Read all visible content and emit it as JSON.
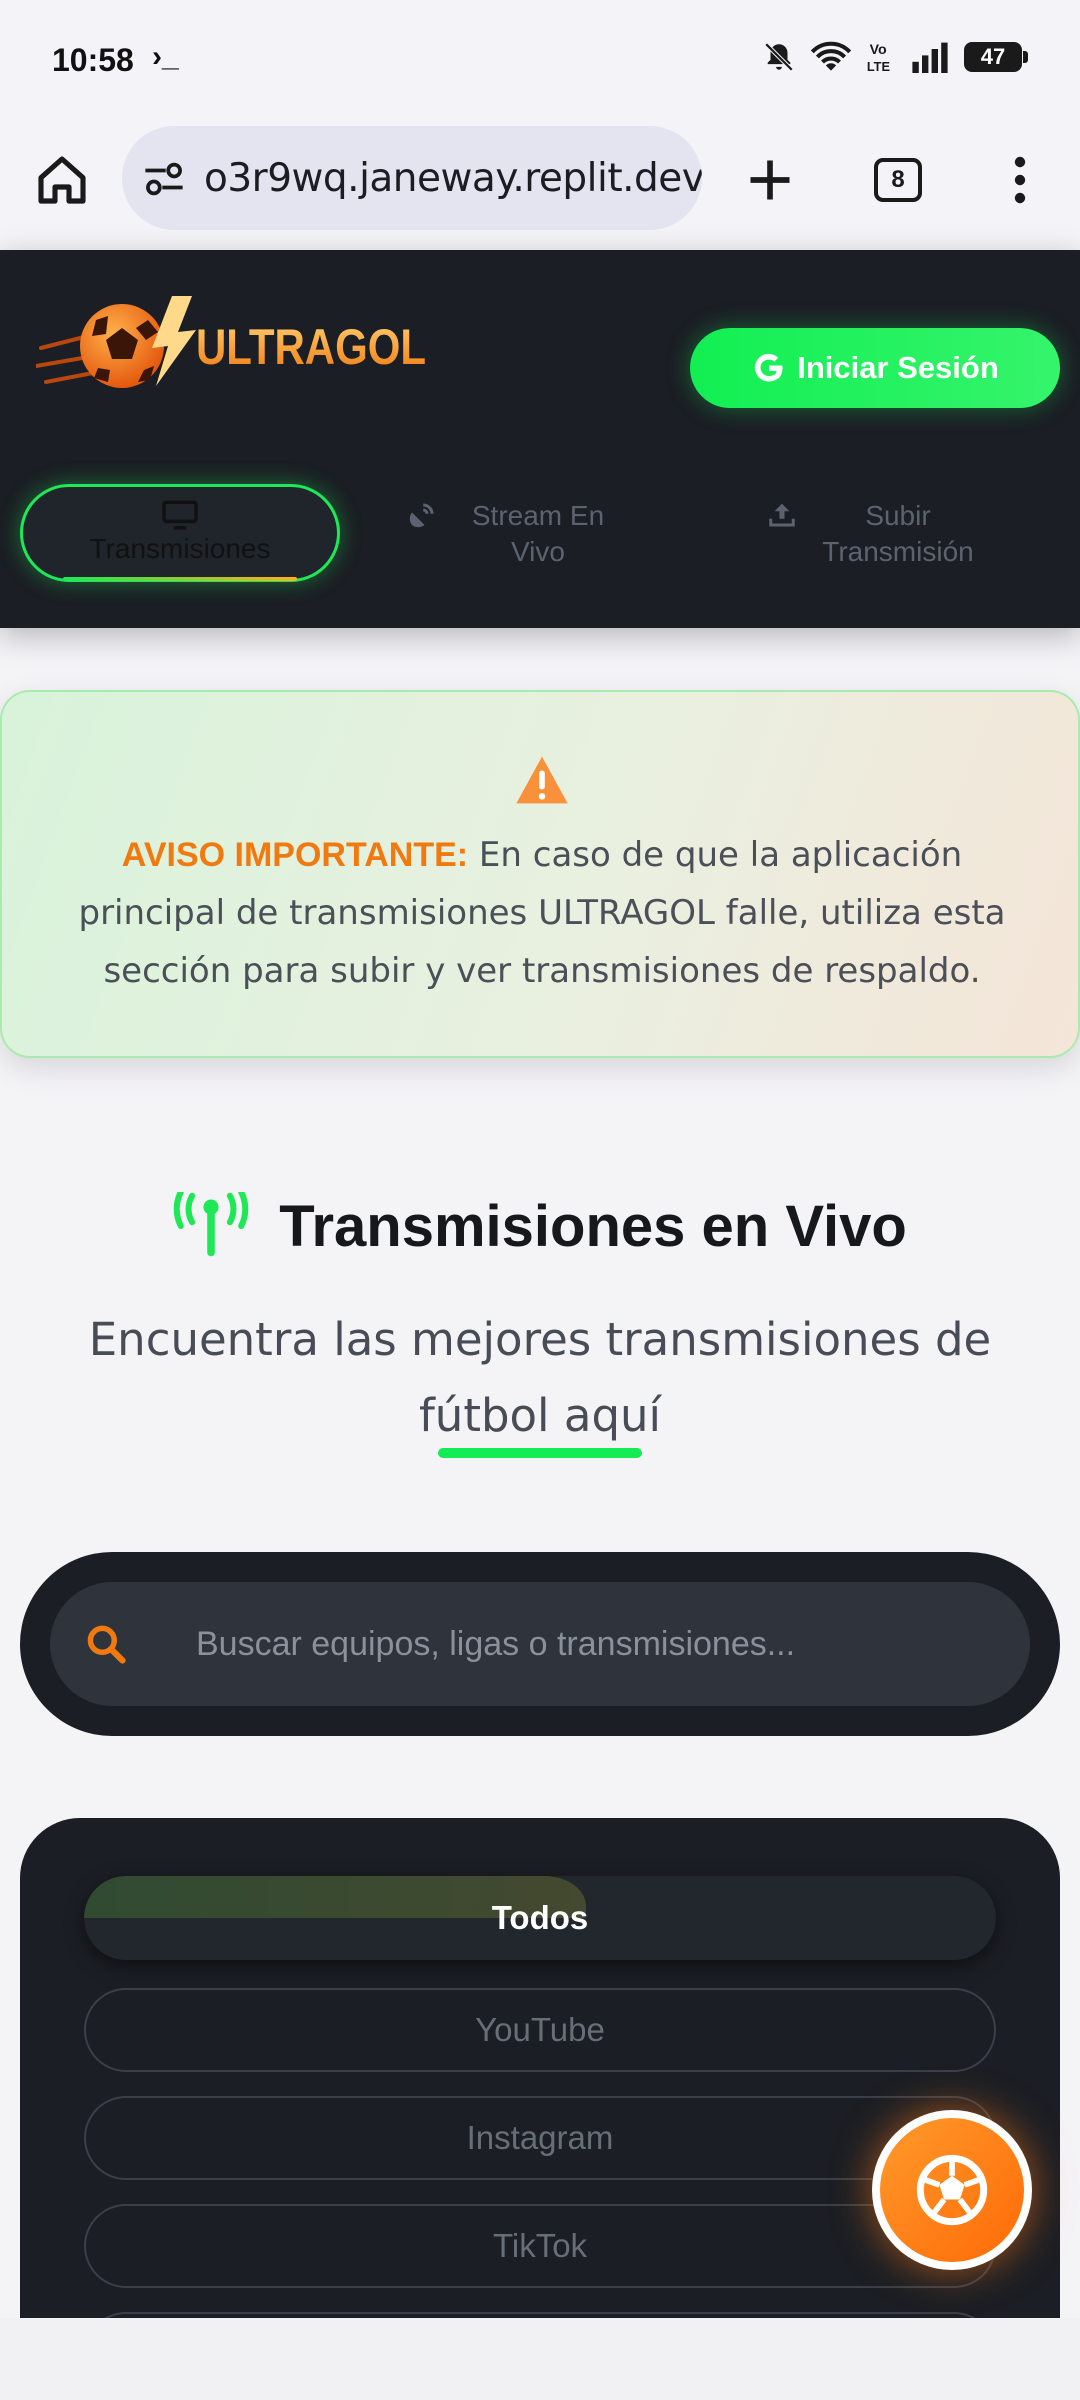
{
  "status_bar": {
    "time": "10:58",
    "prompt": "›_",
    "battery": "47"
  },
  "browser": {
    "url": "o3r9wq.janeway.replit.dev",
    "tab_count": "8"
  },
  "header": {
    "login_label": "Iniciar Sesión",
    "nav": [
      {
        "label": "Transmisiones",
        "active": true
      },
      {
        "label": "Stream En Vivo",
        "active": false
      },
      {
        "label": "Subir Transmisión",
        "active": false
      }
    ]
  },
  "notice": {
    "label": "AVISO IMPORTANTE:",
    "text": "En caso de que la aplicación principal de transmisiones ULTRAGOL falle, utiliza esta sección para subir y ver transmisiones de respaldo."
  },
  "section": {
    "title": "Transmisiones en Vivo",
    "subtitle": "Encuentra las mejores transmisiones de fútbol aquí"
  },
  "search": {
    "placeholder": "Buscar equipos, ligas o transmisiones..."
  },
  "filters": [
    {
      "label": "Todos",
      "active": true,
      "progress": 0.55
    },
    {
      "label": "YouTube",
      "active": false
    },
    {
      "label": "Instagram",
      "active": false
    },
    {
      "label": "TikTok",
      "active": false
    }
  ],
  "colors": {
    "accent_green": "#14ec56",
    "accent_orange": "#f07a10",
    "dark_panel": "#1b1e24"
  },
  "icons": [
    "home-icon",
    "site-settings-icon",
    "plus-icon",
    "tabs-icon",
    "menu-icon",
    "monitor-icon",
    "broadcast-icon",
    "upload-icon",
    "warning-icon",
    "antenna-icon",
    "search-icon",
    "soccer-ball-icon"
  ]
}
